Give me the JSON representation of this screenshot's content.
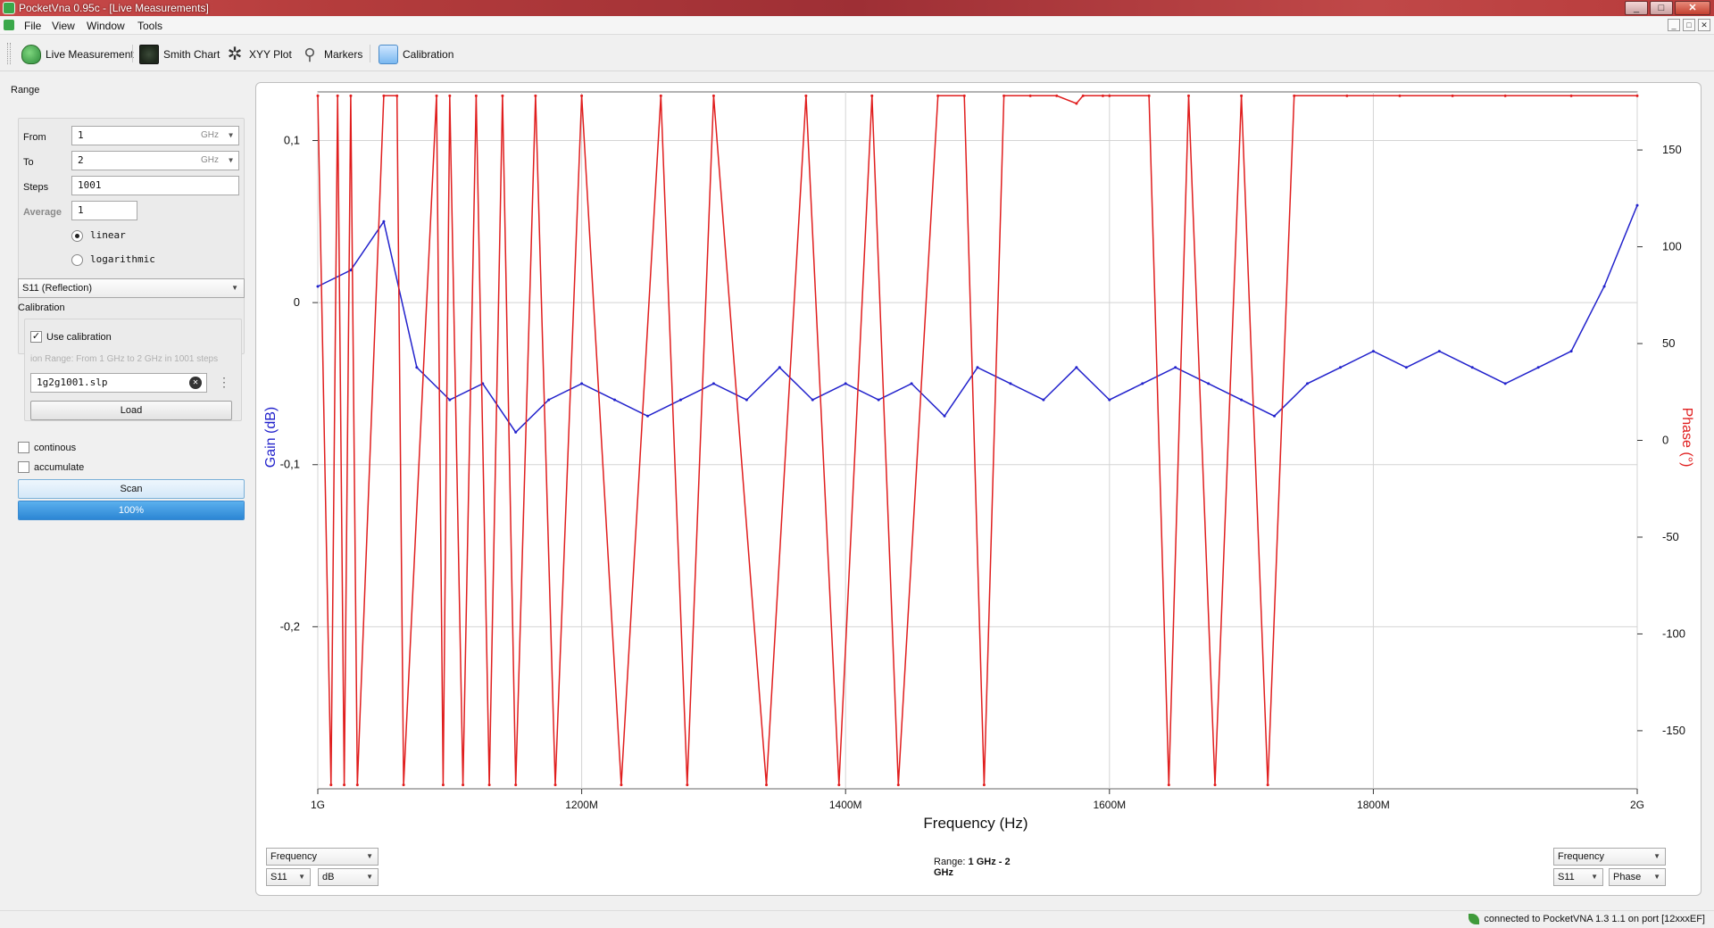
{
  "window": {
    "title": "PocketVna 0.95c - [Live Measurements]",
    "min": "_",
    "max": "□",
    "close": "✕"
  },
  "menu": [
    "File",
    "View",
    "Window",
    "Tools"
  ],
  "mdi_buttons": [
    "_",
    "□",
    "✕"
  ],
  "toolbar": [
    {
      "label": "Live Measurement",
      "icon": "live-measurement-icon"
    },
    {
      "label": "Smith Chart",
      "icon": "smith-chart-icon"
    },
    {
      "label": "XYY Plot",
      "icon": "xyy-plot-icon"
    },
    {
      "label": "Markers",
      "icon": "marker-pin-icon"
    },
    {
      "label": "Calibration",
      "icon": "calibration-icon"
    }
  ],
  "range": {
    "heading": "Range",
    "from_label": "From",
    "from_value": "1",
    "from_unit": "GHz",
    "to_label": "To",
    "to_value": "2",
    "to_unit": "GHz",
    "steps_label": "Steps",
    "steps_value": "1001",
    "average_label": "Average",
    "average_value": "1",
    "linear_label": "linear",
    "log_label": "logarithmic",
    "selected_scale": "linear"
  },
  "sparam_select": "S11 (Reflection)",
  "calibration": {
    "heading": "Calibration",
    "use_label": "Use calibration",
    "use_checked": true,
    "info": "ion Range: From 1 GHz to 2 GHz in 1001 steps",
    "file": "1g2g1001.slp",
    "load_label": "Load"
  },
  "options": {
    "continous_label": "continous",
    "continous_checked": false,
    "accumulate_label": "accumulate",
    "accumulate_checked": false
  },
  "scan_label": "Scan",
  "progress": {
    "value": 1.0,
    "text": "100%"
  },
  "chart_data": {
    "type": "line",
    "xlabel": "Frequency (Hz)",
    "ylabel_left": "Gain (dB)",
    "ylabel_right": "Phase (°)",
    "x_range": [
      1000,
      2000
    ],
    "x_ticks": [
      {
        "value": 1000,
        "label": "1G"
      },
      {
        "value": 1200,
        "label": "1200M"
      },
      {
        "value": 1400,
        "label": "1400M"
      },
      {
        "value": 1600,
        "label": "1600M"
      },
      {
        "value": 1800,
        "label": "1800M"
      },
      {
        "value": 2000,
        "label": "2G"
      }
    ],
    "y_left_range": [
      -0.3,
      0.13
    ],
    "y_left_ticks": [
      {
        "value": 0.1,
        "label": "0,1"
      },
      {
        "value": 0,
        "label": "0"
      },
      {
        "value": -0.1,
        "label": "-0,1"
      },
      {
        "value": -0.2,
        "label": "-0,2"
      }
    ],
    "y_right_range": [
      -180,
      180
    ],
    "y_right_ticks": [
      {
        "value": 150,
        "label": "150"
      },
      {
        "value": 100,
        "label": "100"
      },
      {
        "value": 50,
        "label": "50"
      },
      {
        "value": 0,
        "label": "0"
      },
      {
        "value": -50,
        "label": "-50"
      },
      {
        "value": -100,
        "label": "-100"
      },
      {
        "value": -150,
        "label": "-150"
      }
    ],
    "grid": true,
    "series": [
      {
        "axis": "left",
        "color": "#2222cc",
        "x": [
          1000,
          1025,
          1050,
          1075,
          1100,
          1125,
          1150,
          1175,
          1200,
          1225,
          1250,
          1275,
          1300,
          1325,
          1350,
          1375,
          1400,
          1425,
          1450,
          1475,
          1500,
          1525,
          1550,
          1575,
          1600,
          1625,
          1650,
          1675,
          1700,
          1725,
          1750,
          1775,
          1800,
          1825,
          1850,
          1875,
          1900,
          1925,
          1950,
          1975,
          2000
        ],
        "values": [
          0.01,
          0.02,
          0.05,
          -0.04,
          -0.06,
          -0.05,
          -0.08,
          -0.06,
          -0.05,
          -0.06,
          -0.07,
          -0.06,
          -0.05,
          -0.06,
          -0.04,
          -0.06,
          -0.05,
          -0.06,
          -0.05,
          -0.07,
          -0.04,
          -0.05,
          -0.06,
          -0.04,
          -0.06,
          -0.05,
          -0.04,
          -0.05,
          -0.06,
          -0.07,
          -0.05,
          -0.04,
          -0.03,
          -0.04,
          -0.03,
          -0.04,
          -0.05,
          -0.04,
          -0.03,
          0.01,
          0.06
        ]
      },
      {
        "axis": "right",
        "color": "#e01e1e",
        "x": [
          1000,
          1010,
          1015,
          1020,
          1025,
          1030,
          1050,
          1060,
          1065,
          1090,
          1095,
          1100,
          1110,
          1120,
          1130,
          1140,
          1150,
          1165,
          1180,
          1200,
          1230,
          1260,
          1280,
          1300,
          1340,
          1370,
          1395,
          1420,
          1440,
          1470,
          1490,
          1505,
          1520,
          1540,
          1560,
          1575,
          1580,
          1595,
          1600,
          1630,
          1645,
          1660,
          1680,
          1700,
          1720,
          1740,
          1780,
          1820,
          1860,
          1900,
          1950,
          2000
        ],
        "values": [
          178,
          -178,
          178,
          -178,
          178,
          -178,
          178,
          178,
          -178,
          178,
          -178,
          178,
          -178,
          178,
          -178,
          178,
          -178,
          178,
          -178,
          178,
          -178,
          178,
          -178,
          178,
          -178,
          178,
          -178,
          178,
          -178,
          178,
          178,
          -178,
          178,
          178,
          178,
          174,
          178,
          178,
          178,
          178,
          -178,
          178,
          -178,
          178,
          -178,
          178,
          178,
          178,
          178,
          178,
          178,
          178
        ]
      }
    ]
  },
  "bottom": {
    "left_mode": "Frequency",
    "left_param": "S11",
    "left_unit": "dB",
    "range_prefix": "Range:",
    "range_value": "1 GHz - 2 GHz",
    "right_mode": "Frequency",
    "right_param": "S11",
    "right_unit": "Phase"
  },
  "status": "connected to PocketVNA 1.3 1.1 on port [12xxxEF]"
}
